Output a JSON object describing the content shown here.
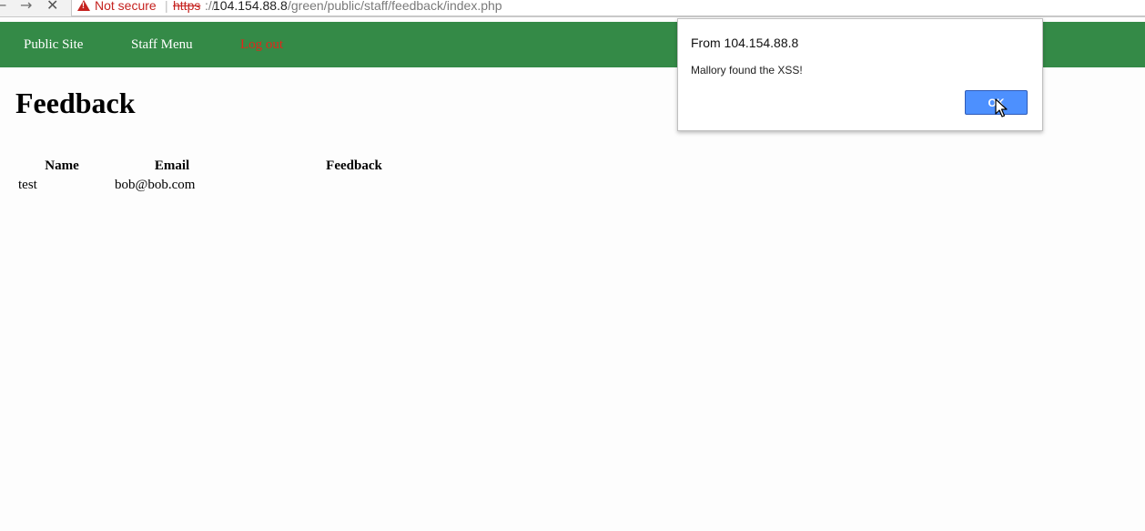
{
  "browser": {
    "back_glyph": "←",
    "forward_glyph": "→",
    "stop_glyph": "✕",
    "security_label": "Not secure",
    "separator": "|",
    "url_scheme": "https",
    "url_scheme_rest": "://",
    "url_host": "104.154.88.8",
    "url_path": "/green/public/staff/feedback/index.php"
  },
  "nav": {
    "public_site": "Public Site",
    "staff_menu": "Staff Menu",
    "log_out": "Log out"
  },
  "page": {
    "title": "Feedback"
  },
  "table": {
    "headers": [
      "Name",
      "Email",
      "Feedback"
    ],
    "rows": [
      [
        "test",
        "bob@bob.com",
        ""
      ]
    ]
  },
  "dialog": {
    "title": "From 104.154.88.8",
    "message": "Mallory found the XSS!",
    "ok_label": "OK"
  },
  "colors": {
    "nav_bg": "#348a47",
    "logout": "#e2261a",
    "ok_button": "#4d90fe",
    "warning": "#c5221f"
  }
}
